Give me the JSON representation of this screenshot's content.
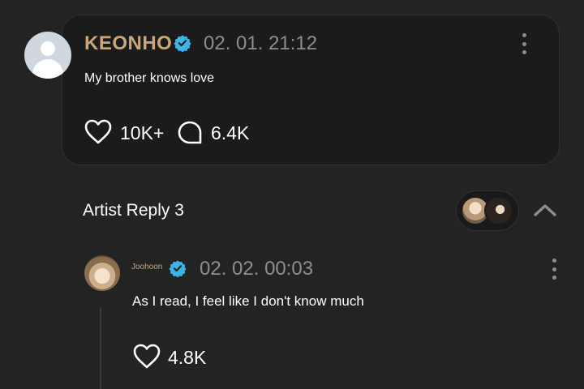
{
  "post": {
    "author": "KEONHO",
    "timestamp": "02. 01. 21:12",
    "text": "My brother knows love",
    "likes": "10K+",
    "comments": "6.4K"
  },
  "artist_reply": {
    "label": "Artist Reply 3"
  },
  "reply": {
    "author": "Joohoon",
    "timestamp": "02. 02. 00:03",
    "text": "As I read, I feel like I don't know much",
    "likes": "4.8K"
  },
  "colors": {
    "background": "#232323",
    "card": "#1b1b1b",
    "author_gold": "#c9a77a",
    "verified_blue": "#39b6e6",
    "muted": "#8e8e8e"
  }
}
